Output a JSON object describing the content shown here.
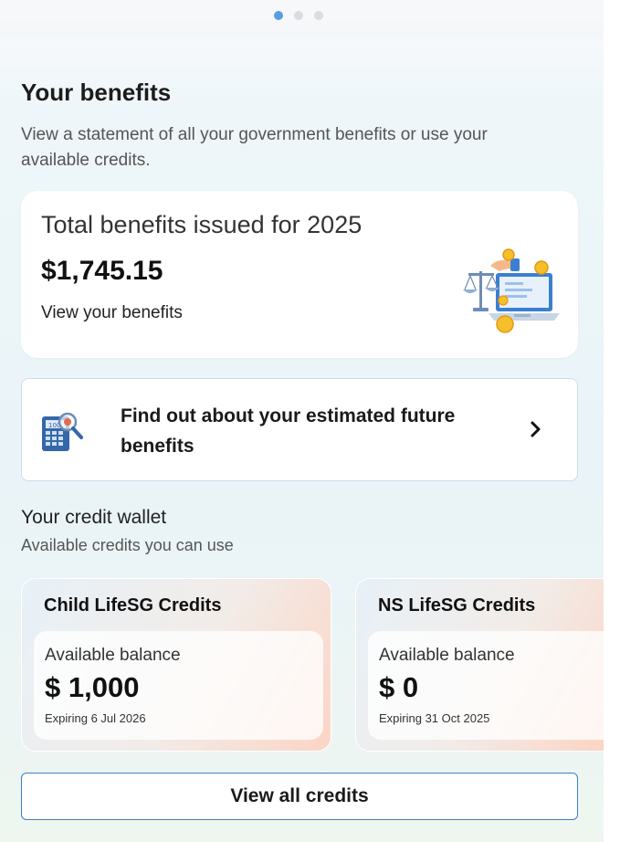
{
  "carousel": {
    "active_index": 0,
    "count": 3
  },
  "benefits": {
    "title": "Your benefits",
    "description": "View a statement of all your government benefits or use your available credits.",
    "card": {
      "label": "Total benefits issued for 2025",
      "amount": "$1,745.15",
      "link": "View your benefits"
    }
  },
  "future": {
    "text": "Find out about your estimated future benefits"
  },
  "wallet": {
    "title": "Your credit wallet",
    "subtitle": "Available credits you can use",
    "credits": [
      {
        "title": "Child LifeSG Credits",
        "balance_label": "Available balance",
        "balance": "$ 1,000",
        "expiry": "Expiring 6 Jul 2026"
      },
      {
        "title": "NS LifeSG Credits",
        "balance_label": "Available balance",
        "balance": "$ 0",
        "expiry": "Expiring 31 Oct 2025"
      }
    ],
    "view_all": "View all credits"
  },
  "colors": {
    "accent": "#3a7fc8",
    "dot_active": "#5a9de0",
    "card_peach": "#fcd4c4"
  }
}
